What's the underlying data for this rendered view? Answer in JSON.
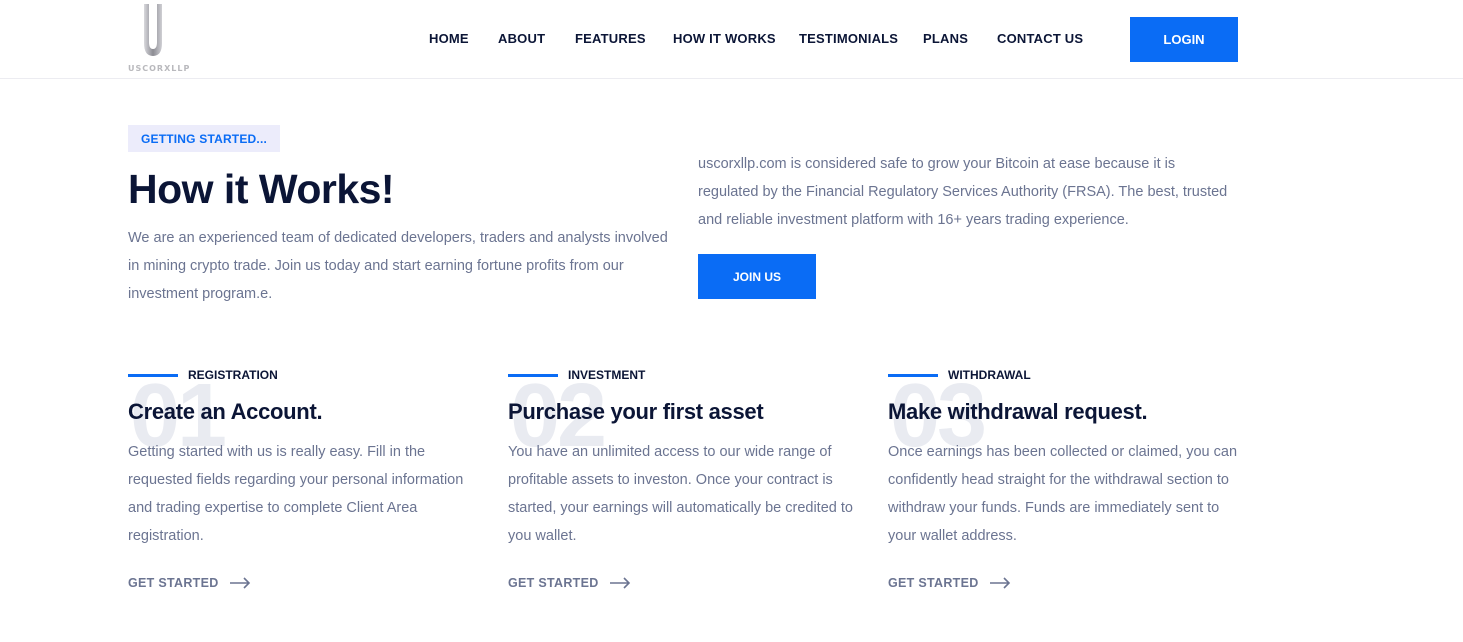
{
  "header": {
    "logo_text": "USCORXLLP",
    "nav": [
      "HOME",
      "ABOUT",
      "FEATURES",
      "HOW IT WORKS",
      "TESTIMONIALS",
      "PLANS",
      "CONTACT US"
    ],
    "login_label": "LOGIN"
  },
  "hero": {
    "tag": "GETTING STARTED...",
    "title": "How it Works!",
    "text": "We are an experienced team of dedicated developers, traders and analysts involved in mining crypto trade. Join us today and start earning fortune profits from our investment program.e.",
    "right_text": "uscorxllp.com is considered safe to grow your Bitcoin at ease because it is regulated by the Financial Regulatory Services Authority (FRSA). The best, trusted and reliable investment platform with 16+ years trading experience.",
    "join_label": "JOIN US"
  },
  "steps": [
    {
      "number": "01",
      "label": "REGISTRATION",
      "title": "Create an Account.",
      "text": "Getting started with us is really easy. Fill in the requested fields regarding your personal information and trading expertise to complete Client Area registration.",
      "link": "GET STARTED"
    },
    {
      "number": "02",
      "label": "INVESTMENT",
      "title": "Purchase your first asset",
      "text": "You have an unlimited access to our wide range of profitable assets to investon. Once your contract is started, your earnings will automatically be credited to you wallet.",
      "link": "GET STARTED"
    },
    {
      "number": "03",
      "label": "WITHDRAWAL",
      "title": "Make withdrawal request.",
      "text": "Once earnings has been collected or claimed, you can confidently head straight for the withdrawal section to withdraw your funds. Funds are immediately sent to your wallet address.",
      "link": "GET STARTED"
    }
  ],
  "colors": {
    "accent": "#0a6cf5",
    "heading": "#0b1536",
    "body_text": "#6b7491",
    "tag_bg": "#ececfb"
  },
  "icons": {
    "arrow": "arrow-right-icon",
    "logo": "logo-icon"
  }
}
